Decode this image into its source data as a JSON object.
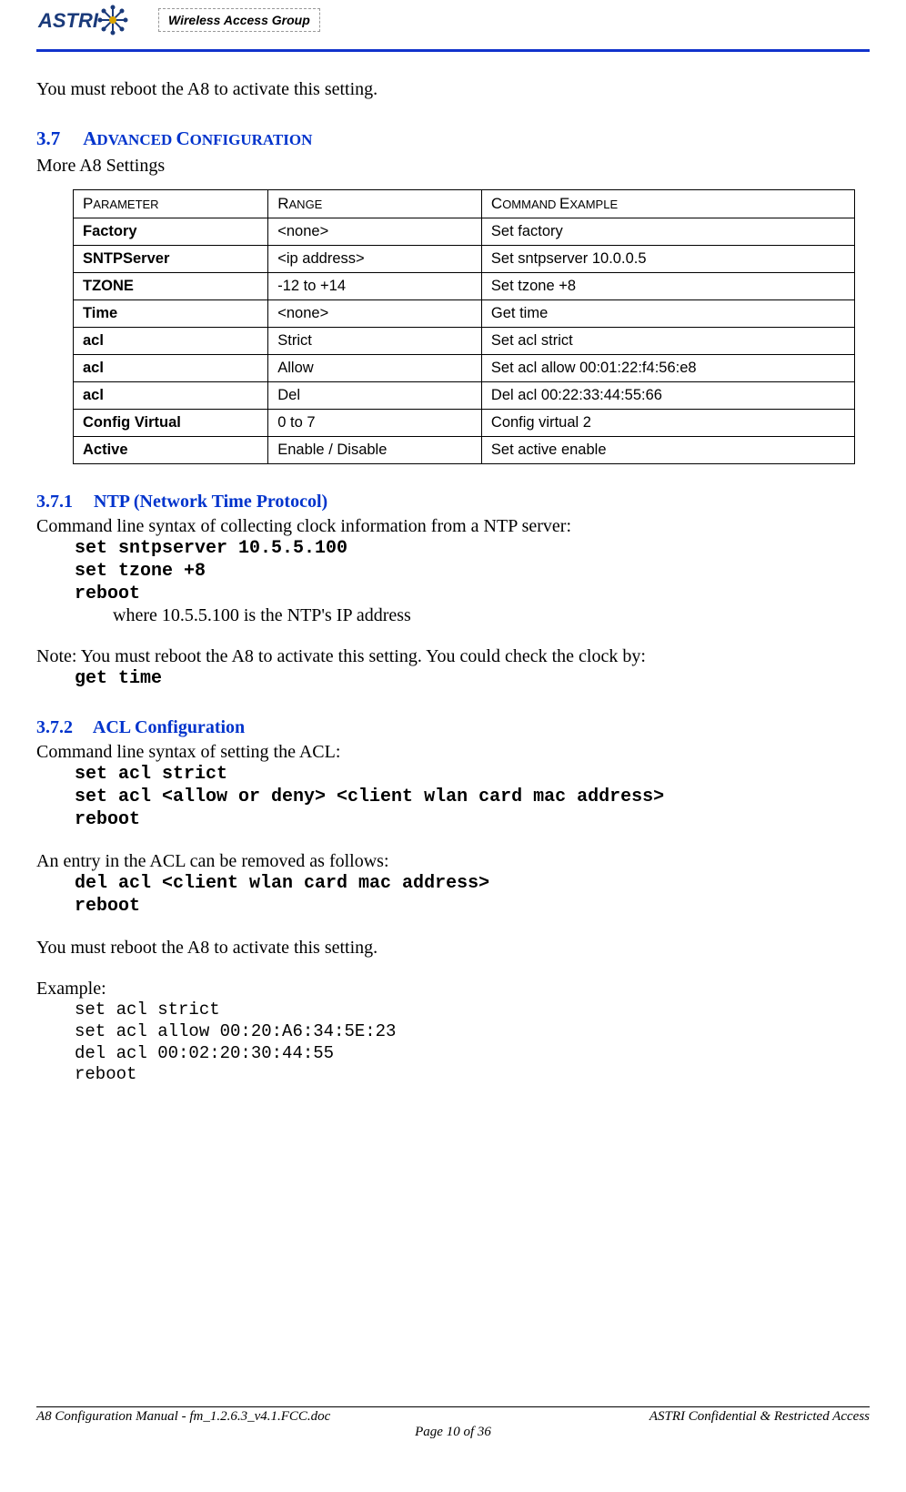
{
  "header": {
    "logo_text": "ASTRI",
    "tagline": "Wireless Access Group"
  },
  "p_top": "You must reboot the A8 to activate this setting.",
  "section37": {
    "num": "3.7",
    "title": "ADVANCED CONFIGURATION",
    "intro": "More A8 Settings"
  },
  "table": {
    "headers": [
      "PARAMETER",
      "RANGE",
      "COMMAND EXAMPLE"
    ],
    "rows": [
      {
        "param": "Factory",
        "range": "<none>",
        "example": "Set factory"
      },
      {
        "param": "SNTPServer",
        "range": "<ip address>",
        "example": "Set sntpserver 10.0.0.5"
      },
      {
        "param": "TZONE",
        "range": "-12 to +14",
        "example": "Set tzone +8"
      },
      {
        "param": "Time",
        "range": "<none>",
        "example": "Get time"
      },
      {
        "param": "acl",
        "range": "Strict",
        "example": "Set acl strict"
      },
      {
        "param": "acl",
        "range": "Allow",
        "example": "Set acl allow 00:01:22:f4:56:e8"
      },
      {
        "param": "acl",
        "range": "Del",
        "example": "Del acl 00:22:33:44:55:66"
      },
      {
        "param": "Config Virtual",
        "range": "0 to 7",
        "example": "Config virtual 2"
      },
      {
        "param": "Active",
        "range": "Enable / Disable",
        "example": "Set active enable"
      }
    ]
  },
  "section371": {
    "num": "3.7.1",
    "title": "NTP (Network Time Protocol)",
    "intro": "Command line syntax of collecting clock information from a NTP server:",
    "cmd1": "set sntpserver 10.5.5.100",
    "cmd2": "set tzone +8",
    "cmd3": "reboot",
    "where": "where 10.5.5.100 is the NTP's IP address",
    "note": "Note: You must reboot the A8 to activate this setting. You could check the clock by:",
    "cmd4": "get time"
  },
  "section372": {
    "num": "3.7.2",
    "title": "ACL Configuration",
    "intro": "Command line syntax of setting the ACL:",
    "cmd1": "set acl strict",
    "cmd2": "set acl <allow or deny> <client wlan card mac address>",
    "cmd3": "reboot",
    "p2": "An entry in the ACL can be removed as follows:",
    "cmd4": "del acl <client wlan card mac address>",
    "cmd5": "reboot",
    "p3": "You must reboot the A8 to activate this setting.",
    "example_label": "Example:",
    "ex1": "set acl strict",
    "ex2": "set acl allow 00:20:A6:34:5E:23",
    "ex3": "del acl 00:02:20:30:44:55",
    "ex4": "reboot"
  },
  "footer": {
    "left": "A8 Configuration Manual - fm_1.2.6.3_v4.1.FCC.doc",
    "right": "ASTRI Confidential & Restricted Access",
    "center": "Page 10 of 36"
  }
}
